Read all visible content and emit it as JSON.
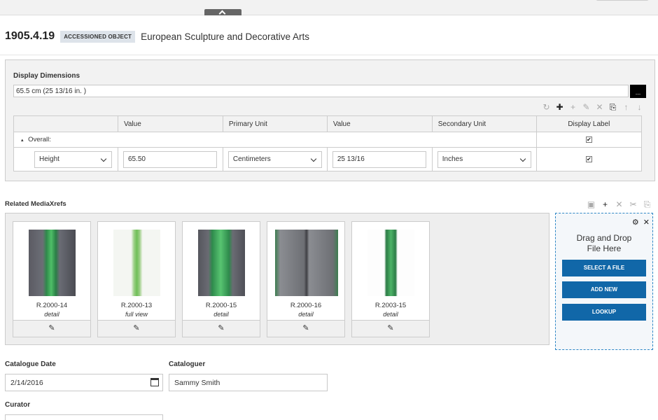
{
  "header": {
    "object_number": "1905.4.19",
    "badge": "ACCESSIONED OBJECT",
    "department": "European Sculpture and Decorative Arts"
  },
  "display_dimensions": {
    "label": "Display Dimensions",
    "value": "65.5 cm (25 13/16 in. )",
    "more_label": "..."
  },
  "dimension_table": {
    "columns": [
      "",
      "Value",
      "Primary Unit",
      "Value",
      "Secondary Unit",
      "Display Label"
    ],
    "group_label": "Overall:",
    "row": {
      "dimension": "Height",
      "primary_value": "65.50",
      "primary_unit": "Centimeters",
      "secondary_value": "25 13/16",
      "secondary_unit": "Inches"
    }
  },
  "media": {
    "title": "Related MediaXrefs",
    "items": [
      {
        "name": "R.2000-14",
        "desc": "detail"
      },
      {
        "name": "R.2000-13",
        "desc": "full view"
      },
      {
        "name": "R.2000-15",
        "desc": "detail"
      },
      {
        "name": "R.2000-16",
        "desc": "detail"
      },
      {
        "name": "R.2003-15",
        "desc": "detail"
      }
    ]
  },
  "dropzone": {
    "line1": "Drag and Drop",
    "line2": "File Here",
    "select_file": "SELECT A FILE",
    "add_new": "ADD NEW",
    "lookup": "LOOKUP"
  },
  "catalogue": {
    "date_label": "Catalogue Date",
    "date_value": "2/14/2016",
    "cataloguer_label": "Cataloguer",
    "cataloguer_value": "Sammy Smith",
    "curator_label": "Curator"
  },
  "colors": {
    "accent": "#1167a8",
    "dropzone_border": "#2e87c6"
  }
}
